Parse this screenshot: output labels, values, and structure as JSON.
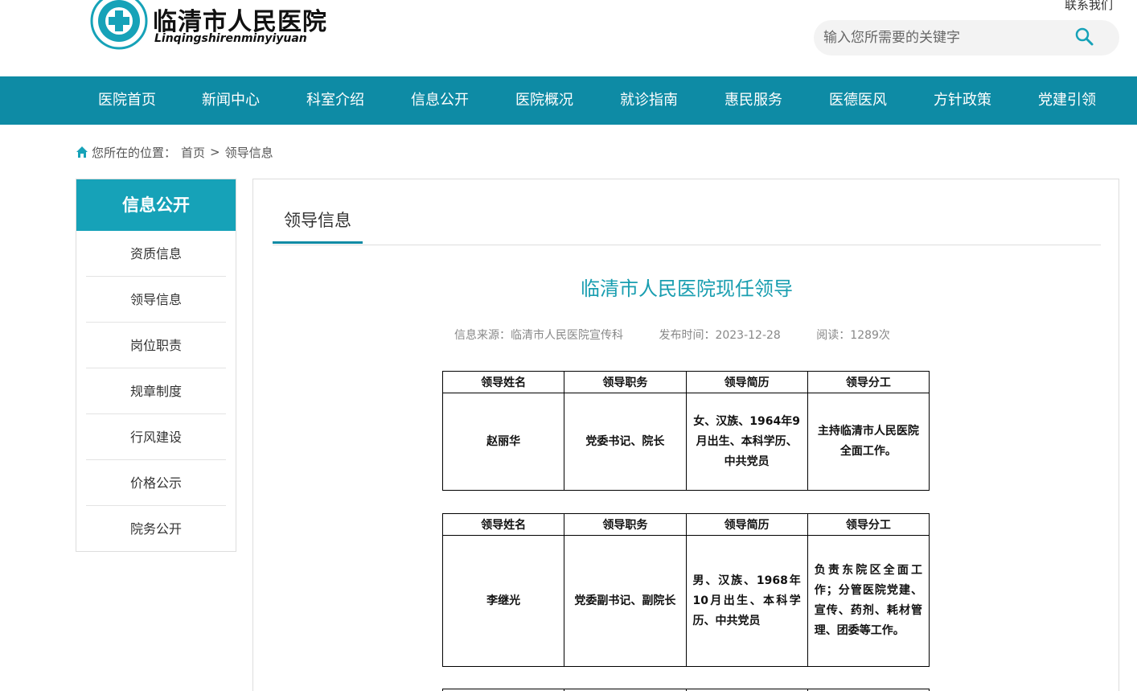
{
  "header": {
    "logo_title": "临清市人民医院",
    "logo_subtitle": "Linqingshirenminyiyuan",
    "contact_link": "联系我们",
    "search_placeholder": "输入您所需要的关键字",
    "search_icon": "search-icon",
    "brand_color": "#0e8ba5"
  },
  "nav": {
    "items": [
      "医院首页",
      "新闻中心",
      "科室介绍",
      "信息公开",
      "医院概况",
      "就诊指南",
      "惠民服务",
      "医德医风",
      "方针政策",
      "党建引领"
    ]
  },
  "breadcrumb": {
    "icon": "home-icon",
    "label": "您所在的位置：",
    "home": "首页",
    "separator": ">",
    "current": "领导信息"
  },
  "sidebar": {
    "title": "信息公开",
    "accent_color": "#16a2b8",
    "items": [
      "资质信息",
      "领导信息",
      "岗位职责",
      "规章制度",
      "行风建设",
      "价格公示",
      "院务公开"
    ]
  },
  "main": {
    "tab": "领导信息",
    "title": "临清市人民医院现任领导",
    "title_color": "#199eb0",
    "meta": {
      "source": "信息来源：临清市人民医院宣传科",
      "date": "发布时间：2023-12-28",
      "views": "阅读：1289次"
    },
    "table_headers": [
      "领导姓名",
      "领导职务",
      "领导简历",
      "领导分工"
    ],
    "leaders": [
      {
        "name": "赵丽华",
        "position": "党委书记、院长",
        "resume": "女、汉族、1964年9月出生、本科学历、中共党员",
        "duty": "主持临清市人民医院全面工作。"
      },
      {
        "name": "李继光",
        "position": "党委副书记、副院长",
        "resume": "男、汉族、1968年10月出生、本科学历、中共党员",
        "duty": "负责东院区全面工作；分管医院党建、宣传、药剂、耗材管理、团委等工作。"
      }
    ]
  }
}
